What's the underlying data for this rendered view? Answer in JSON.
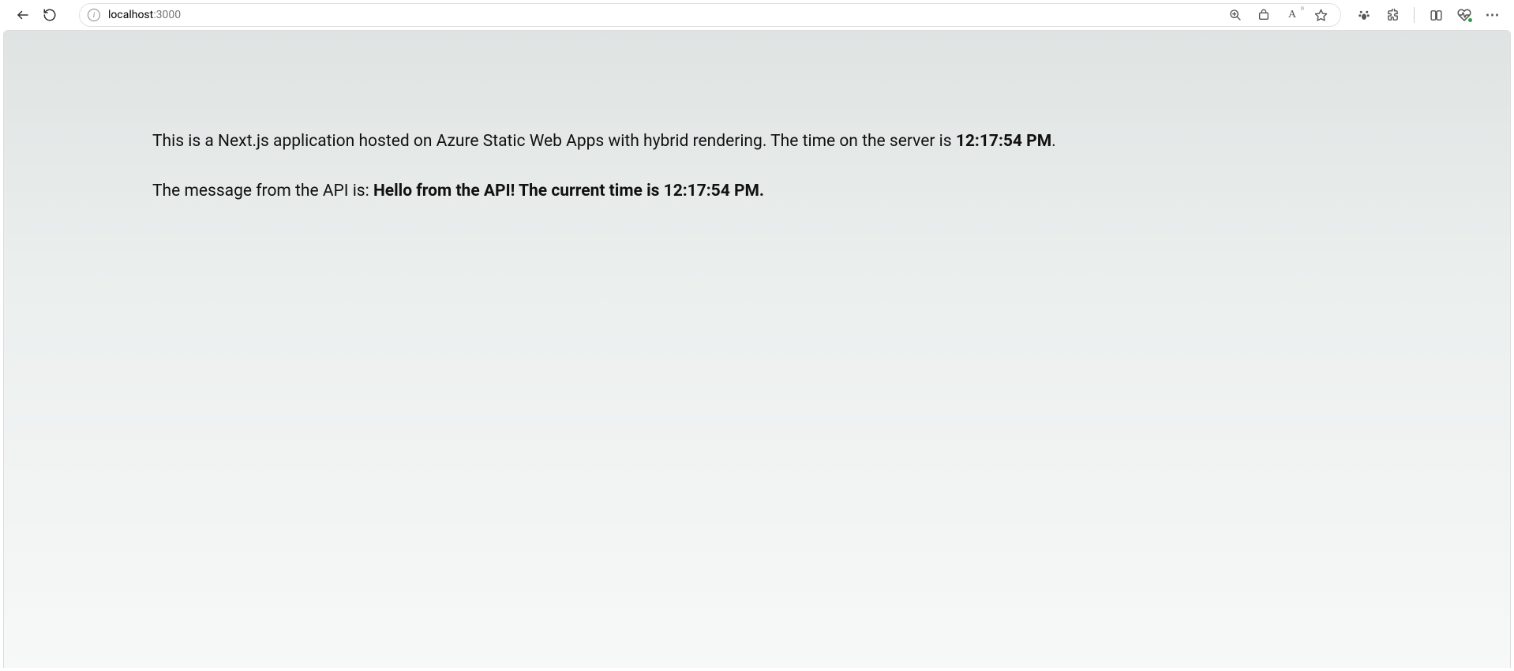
{
  "browser": {
    "url_host": "localhost",
    "url_port": ":3000"
  },
  "page": {
    "line1_prefix": "This is a Next.js application hosted on Azure Static Web Apps with hybrid rendering. The time on the server is ",
    "server_time": "12:17:54 PM",
    "line1_suffix": ".",
    "line2_prefix": "The message from the API is: ",
    "api_message": "Hello from the API! The current time is 12:17:54 PM."
  }
}
